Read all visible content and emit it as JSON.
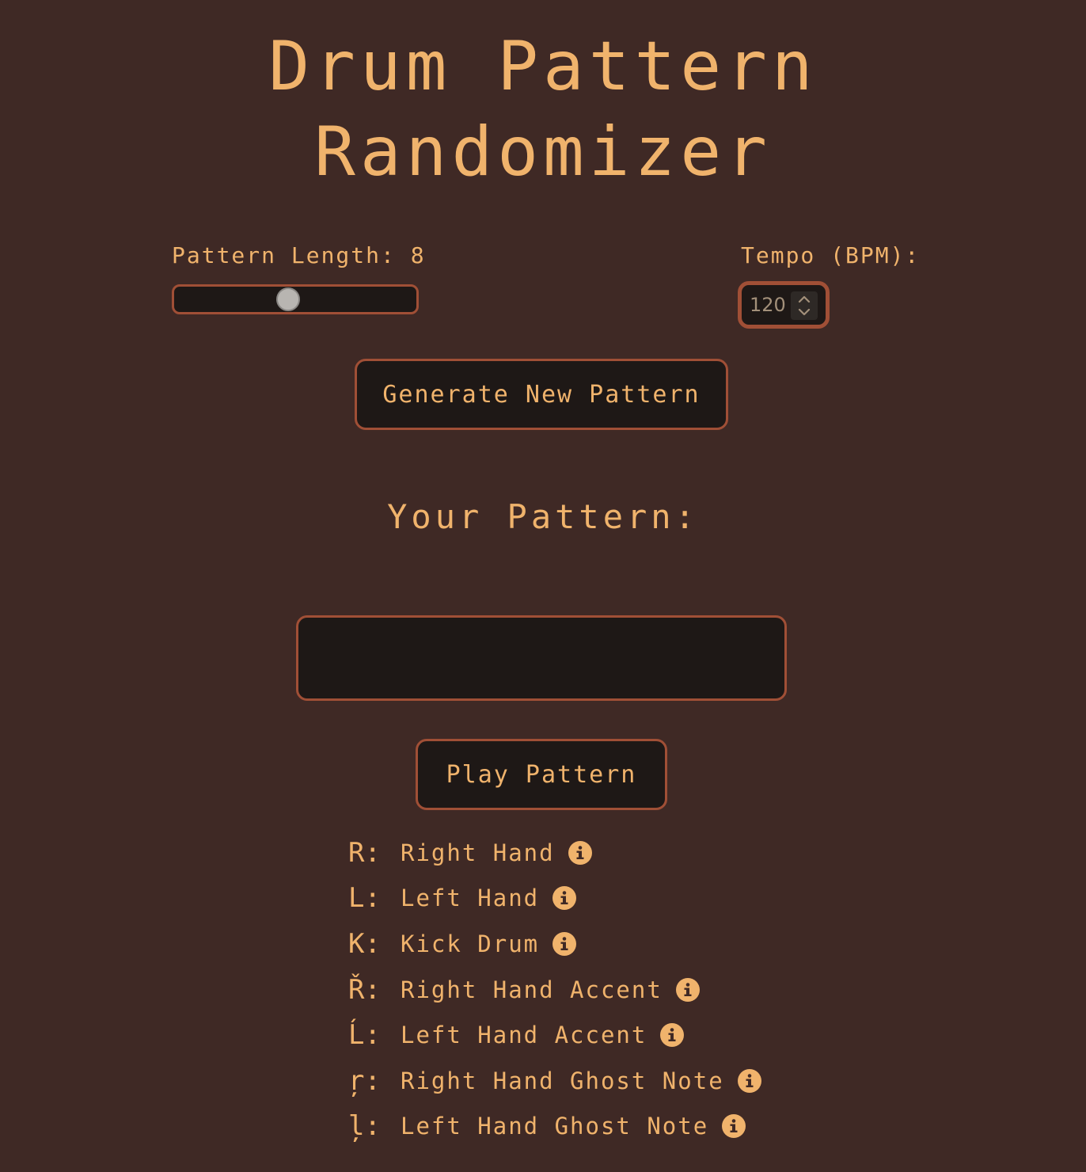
{
  "title_line1": "Drum Pattern",
  "title_line2": "Randomizer",
  "controls": {
    "length_label": "Pattern Length: 8",
    "length_value": 8,
    "length_fraction": 0.47,
    "tempo_label": "Tempo (BPM):",
    "tempo_value": "120"
  },
  "generate_label": "Generate New Pattern",
  "pattern_heading": "Your Pattern:",
  "pattern_text": "",
  "play_label": "Play Pattern",
  "legend": [
    {
      "symbol": "R:",
      "label": "Right Hand",
      "icon": "info-icon"
    },
    {
      "symbol": "L:",
      "label": "Left Hand",
      "icon": "info-icon"
    },
    {
      "symbol": "K:",
      "label": "Kick Drum",
      "icon": "info-icon"
    },
    {
      "symbol": "Ř:",
      "label": "Right Hand Accent",
      "icon": "info-icon"
    },
    {
      "symbol": "Ĺ:",
      "label": "Left Hand Accent",
      "icon": "info-icon"
    },
    {
      "symbol": "ŗ:",
      "label": "Right Hand Ghost Note",
      "icon": "info-icon"
    },
    {
      "symbol": "ļ:",
      "label": "Left Hand Ghost Note",
      "icon": "info-icon"
    }
  ],
  "colors": {
    "background": "#3f2925",
    "accent_text": "#f0b36c",
    "border": "#a04f36",
    "box_fill": "#1e1816"
  }
}
